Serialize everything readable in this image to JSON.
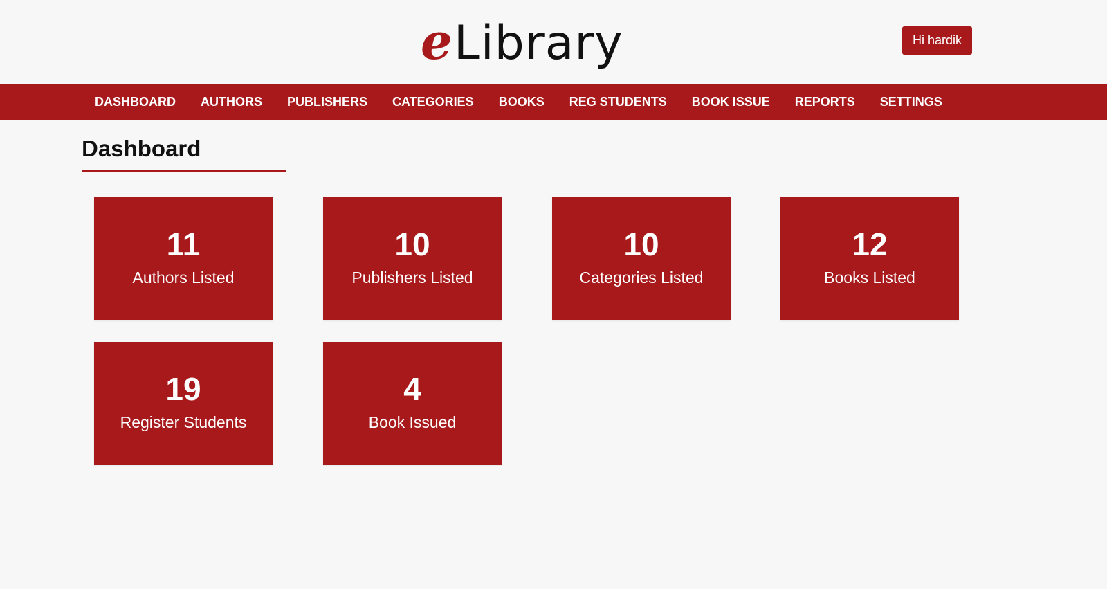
{
  "header": {
    "logo_e": "e",
    "logo_rest": "Library",
    "user_greeting": "Hi hardik"
  },
  "nav": {
    "items": [
      {
        "label": "DASHBOARD"
      },
      {
        "label": "AUTHORS"
      },
      {
        "label": "PUBLISHERS"
      },
      {
        "label": "CATEGORIES"
      },
      {
        "label": "BOOKS"
      },
      {
        "label": "REG STUDENTS"
      },
      {
        "label": "BOOK ISSUE"
      },
      {
        "label": "REPORTS"
      },
      {
        "label": "SETTINGS"
      }
    ]
  },
  "page": {
    "title": "Dashboard"
  },
  "cards": [
    {
      "count": "11",
      "label": "Authors Listed"
    },
    {
      "count": "10",
      "label": "Publishers Listed"
    },
    {
      "count": "10",
      "label": "Categories Listed"
    },
    {
      "count": "12",
      "label": "Books Listed"
    },
    {
      "count": "19",
      "label": "Register Students"
    },
    {
      "count": "4",
      "label": "Book Issued"
    }
  ],
  "colors": {
    "brand": "#a8191c",
    "background": "#f7f7f7",
    "text": "#111111"
  }
}
